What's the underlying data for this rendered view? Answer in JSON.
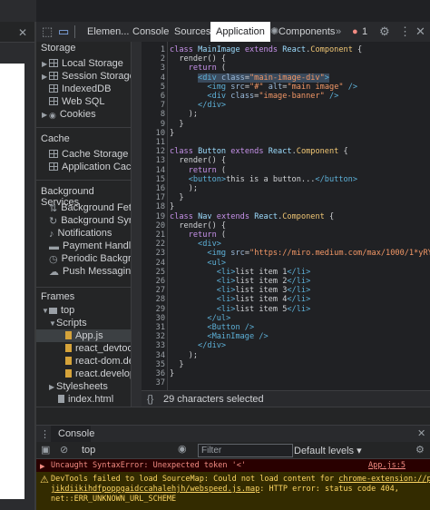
{
  "toolbar": {
    "tabs": [
      "Elemen...",
      "Console",
      "Sources",
      "Application",
      "Components"
    ],
    "more": "»",
    "error_count": "1"
  },
  "sidebar": {
    "storage_title": "Storage",
    "storage_items": [
      "Local Storage",
      "Session Storage",
      "IndexedDB",
      "Web SQL",
      "Cookies"
    ],
    "cache_title": "Cache",
    "cache_items": [
      "Cache Storage",
      "Application Cache"
    ],
    "bg_title": "Background Services",
    "bg_items": [
      "Background Fetch",
      "Background Sync",
      "Notifications",
      "Payment Handler",
      "Periodic Background",
      "Push Messaging"
    ],
    "frames_title": "Frames",
    "frames_top": "top",
    "scripts_label": "Scripts",
    "scripts": [
      "App.js",
      "react_devtools_b",
      "react-dom.deve",
      "react.developm"
    ],
    "stylesheets_label": "Stylesheets",
    "index_file": "index.html"
  },
  "editor": {
    "line_numbers": [
      "1",
      "2",
      "3",
      "4",
      "5",
      "6",
      "7",
      "8",
      "9",
      "10",
      "11",
      "12",
      "13",
      "14",
      "15",
      "16",
      "17",
      "18",
      "19",
      "20",
      "21",
      "22",
      "23",
      "24",
      "25",
      "26",
      "27",
      "28",
      "29",
      "30",
      "31",
      "32",
      "33",
      "34",
      "35",
      "36",
      "37"
    ],
    "status": "29 characters selected",
    "status_icon": "{}"
  },
  "console": {
    "tab": "Console",
    "context": "top",
    "filter_placeholder": "Filter",
    "levels": "Default levels ▾",
    "error_text": "Uncaught SyntaxError: Unexpected token '<'",
    "error_source": "App.js:5",
    "warn_text1": "DevTools failed to load SourceMap: Could not load content for ",
    "warn_link": "chrome-extension://pgj",
    "warn_text2": "jikdiikihdfpoppgaidccahalehjh/webspeed.js.map",
    "warn_text3": ": HTTP error: status code 404,",
    "warn_text4": "net::ERR_UNKNOWN_URL_SCHEME"
  },
  "colors": {
    "accent_active_tab": "#ffffff",
    "error_bg": "#290000",
    "warning_bg": "#332b00",
    "selection": "#3c4043"
  }
}
